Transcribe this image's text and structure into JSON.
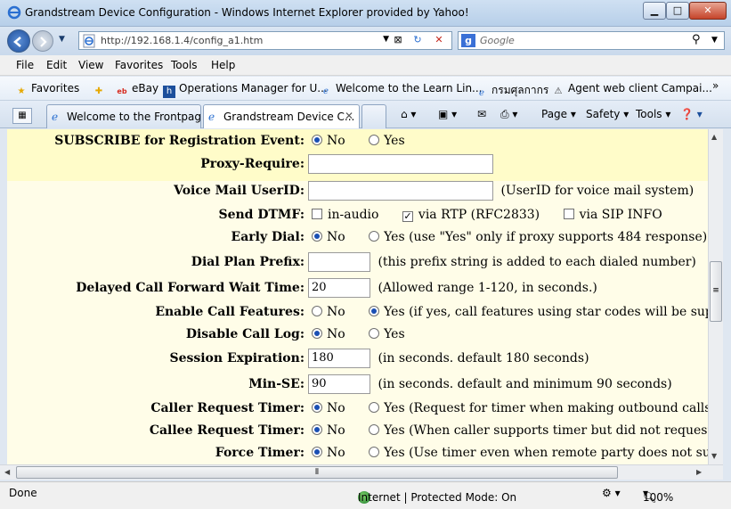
{
  "window": {
    "title": "Grandstream Device Configuration - Windows Internet Explorer provided by Yahoo!",
    "min_glyph": "▁",
    "max_glyph": "□",
    "close_glyph": "✕"
  },
  "address": {
    "url": "http://192.168.1.4/config_a1.htm",
    "search_placeholder": "Google"
  },
  "menu": [
    "File",
    "Edit",
    "View",
    "Favorites",
    "Tools",
    "Help"
  ],
  "favorites": {
    "label": "Favorites",
    "items": [
      "eBay",
      "Operations Manager for U...",
      "Welcome to the Learn Lin...",
      "กรมศุลกากร",
      "Agent web client Campai..."
    ],
    "more": "»"
  },
  "tabs": {
    "items": [
      {
        "label": "Welcome to the Frontpage"
      },
      {
        "label": "Grandstream Device C..."
      }
    ],
    "commands": {
      "page": "Page",
      "safety": "Safety",
      "tools": "Tools"
    }
  },
  "form": {
    "subscribe": {
      "label": "SUBSCRIBE for Registration Event:",
      "no": "No",
      "yes": "Yes"
    },
    "proxy_require": {
      "label": "Proxy-Require:",
      "value": ""
    },
    "voicemail": {
      "label": "Voice Mail UserID:",
      "value": "",
      "hint": "(UserID for voice mail system)"
    },
    "send_dtmf": {
      "label": "Send DTMF:",
      "in_audio": "in-audio",
      "via_rtp": "via RTP (RFC2833)",
      "via_sip": "via SIP INFO"
    },
    "early_dial": {
      "label": "Early Dial:",
      "no": "No",
      "yes": "Yes (use \"Yes\" only if proxy supports 484 response)"
    },
    "dial_plan_prefix": {
      "label": "Dial Plan Prefix:",
      "value": "",
      "hint": "(this prefix string is added to each dialed number)"
    },
    "delayed_cf": {
      "label": "Delayed Call Forward Wait Time:",
      "value": "20",
      "hint": "(Allowed range 1-120, in seconds.)"
    },
    "call_features": {
      "label": "Enable Call Features:",
      "no": "No",
      "yes": "Yes (if yes, call features using star codes will be supported l"
    },
    "disable_call_log": {
      "label": "Disable Call Log:",
      "no": "No",
      "yes": "Yes"
    },
    "session_expiration": {
      "label": "Session Expiration:",
      "value": "180",
      "hint": "(in seconds. default 180 seconds)"
    },
    "min_se": {
      "label": "Min-SE:",
      "value": "90",
      "hint": "(in seconds. default and minimum 90 seconds)"
    },
    "caller_timer": {
      "label": "Caller Request Timer:",
      "no": "No",
      "yes": "Yes (Request for timer when making outbound calls)"
    },
    "callee_timer": {
      "label": "Callee Request Timer:",
      "no": "No",
      "yes": "Yes (When caller supports timer but did not request one)"
    },
    "force_timer": {
      "label": "Force Timer:",
      "no": "No",
      "yes": "Yes (Use timer even when remote party does not support)"
    }
  },
  "status": {
    "left": "Done",
    "zone": "Internet | Protected Mode: On",
    "zoom": "100%"
  }
}
